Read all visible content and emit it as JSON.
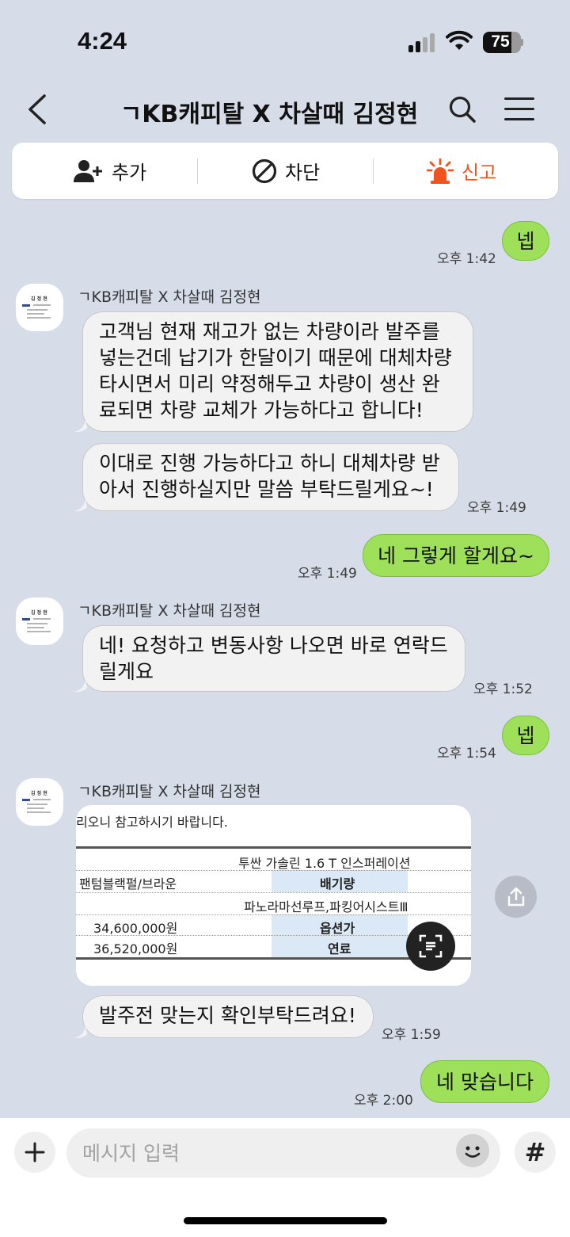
{
  "status_bar": {
    "time": "4:24",
    "battery": "75",
    "battery_level": 0.75
  },
  "header": {
    "title": "ㄱKB캐피탈 X 차살때 김정현"
  },
  "actions": {
    "add": "추가",
    "block": "차단",
    "report": "신고"
  },
  "colors": {
    "outgoing_bubble": "#9ee05a",
    "report": "#f0541e",
    "background": "#d7dce9"
  },
  "messages": [
    {
      "type": "out",
      "text": "넵",
      "time": "오후 1:42"
    },
    {
      "type": "in",
      "sender": "ㄱKB캐피탈 X 차살때 김정현",
      "lines": [
        "고객님 현재 재고가 없는 차량이라 발주를",
        "넣는건데 납기가 한달이기 때문에 대체차량",
        "타시면서 미리 약정해두고 차량이 생산 완",
        "료되면 차량 교체가 가능하다고 합니다!"
      ]
    },
    {
      "type": "in",
      "lines": [
        "이대로 진행 가능하다고 하니 대체차량 받",
        "아서 진행하실지만 말씀 부탁드릴게요~!"
      ],
      "time": "오후 1:49"
    },
    {
      "type": "out",
      "text": "네 그렇게 할게요~",
      "time": "오후 1:49"
    },
    {
      "type": "in",
      "sender": "ㄱKB캐피탈 X 차살때 김정현",
      "lines": [
        "네! 요청하고 변동사항 나오면 바로 연락드",
        "릴게요"
      ],
      "time": "오후 1:52"
    },
    {
      "type": "out",
      "text": "넵",
      "time": "오후 1:54"
    },
    {
      "type": "image",
      "sender": "ㄱKB캐피탈 X 차살때 김정현",
      "image_text": {
        "caption": "리오니 참고하시기 바랍니다.",
        "model": "투싼 가솔린 1.6 T  인스퍼레이션",
        "color": "팬텀블랙펄/브라운",
        "displacement_label": "배기량",
        "options": "파노라마선루프,파킹어시스트Ⅲ",
        "price1": "34,600,000원",
        "option_price_label": "옵션가",
        "price2": "36,520,000원",
        "fuel_label": "연료"
      }
    },
    {
      "type": "in",
      "lines": [
        "발주전 맞는지 확인부탁드려요!"
      ],
      "time": "오후 1:59"
    },
    {
      "type": "out",
      "text": "네 맞습니다",
      "time": "오후 2:00"
    }
  ],
  "input": {
    "placeholder": "메시지 입력",
    "value": ""
  }
}
